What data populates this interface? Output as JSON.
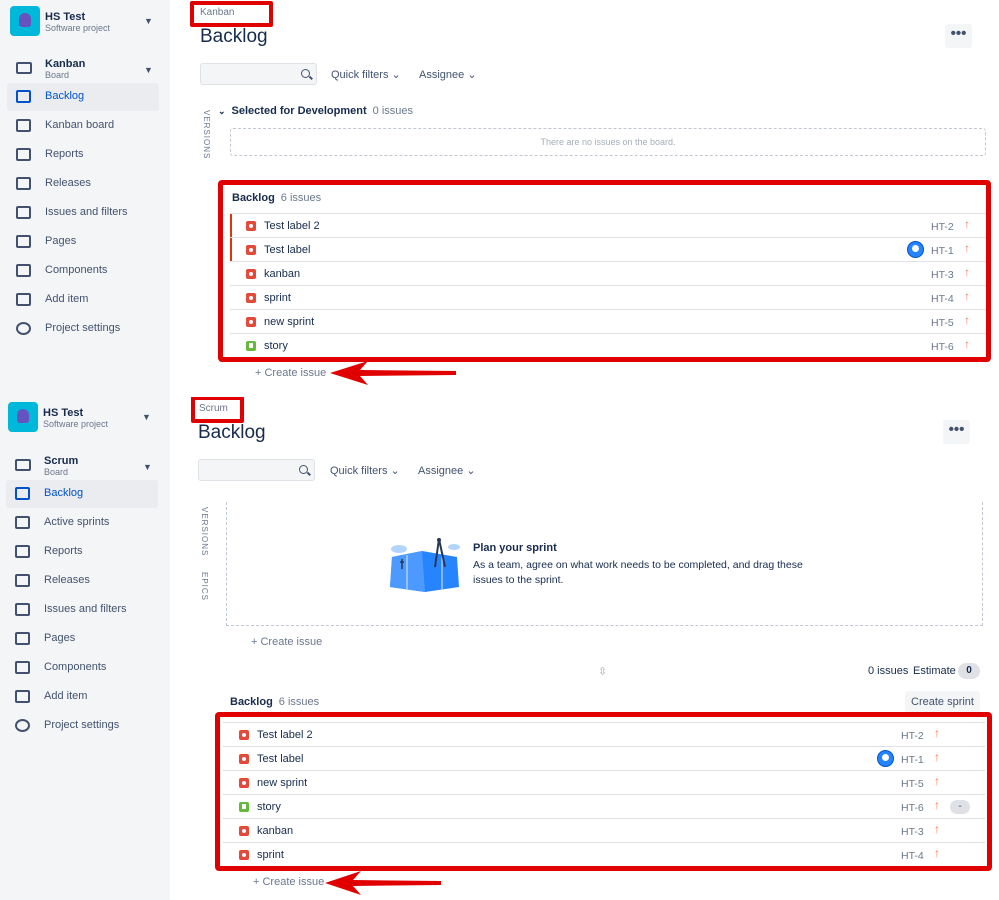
{
  "kanban": {
    "project": {
      "name": "HS Test",
      "type": "Software project"
    },
    "board": {
      "name": "Kanban",
      "type": "Board"
    },
    "nav": [
      "Backlog",
      "Kanban board",
      "Reports",
      "Releases",
      "Issues and filters",
      "Pages",
      "Components",
      "Add item",
      "Project settings"
    ],
    "tag": "Kanban",
    "title": "Backlog",
    "filters": {
      "quick": "Quick filters",
      "assignee": "Assignee"
    },
    "versions_tab": "VERSIONS",
    "selected_section": {
      "title": "Selected for Development",
      "count": "0 issues",
      "empty": "There are no issues on the board."
    },
    "backlog": {
      "title": "Backlog",
      "count": "6 issues",
      "issues": [
        {
          "summary": "Test label 2",
          "key": "HT-2",
          "type": "bug",
          "avatar": false,
          "marked": true
        },
        {
          "summary": "Test label",
          "key": "HT-1",
          "type": "bug",
          "avatar": true,
          "marked": true
        },
        {
          "summary": "kanban",
          "key": "HT-3",
          "type": "bug",
          "avatar": false,
          "marked": false
        },
        {
          "summary": "sprint",
          "key": "HT-4",
          "type": "bug",
          "avatar": false,
          "marked": false
        },
        {
          "summary": "new sprint",
          "key": "HT-5",
          "type": "bug",
          "avatar": false,
          "marked": false
        },
        {
          "summary": "story",
          "key": "HT-6",
          "type": "story",
          "avatar": false,
          "marked": false
        }
      ]
    },
    "create_issue": "+ Create issue"
  },
  "scrum": {
    "project": {
      "name": "HS Test",
      "type": "Software project"
    },
    "board": {
      "name": "Scrum",
      "type": "Board"
    },
    "nav": [
      "Backlog",
      "Active sprints",
      "Reports",
      "Releases",
      "Issues and filters",
      "Pages",
      "Components",
      "Add item",
      "Project settings"
    ],
    "tag": "Scrum",
    "title": "Backlog",
    "filters": {
      "quick": "Quick filters",
      "assignee": "Assignee"
    },
    "versions_tab": "VERSIONS",
    "epics_tab": "EPICS",
    "plan": {
      "title": "Plan your sprint",
      "desc": "As a team, agree on what work needs to be completed, and drag these issues to the sprint."
    },
    "create_issue_sprint": "+ Create issue",
    "sprint_stats": {
      "issues": "0 issues",
      "estimate_label": "Estimate",
      "estimate_value": "0"
    },
    "create_sprint": "Create sprint",
    "backlog": {
      "title": "Backlog",
      "count": "6 issues",
      "issues": [
        {
          "summary": "Test label 2",
          "key": "HT-2",
          "type": "bug",
          "avatar": false,
          "estimate": ""
        },
        {
          "summary": "Test label",
          "key": "HT-1",
          "type": "bug",
          "avatar": true,
          "estimate": ""
        },
        {
          "summary": "new sprint",
          "key": "HT-5",
          "type": "bug",
          "avatar": false,
          "estimate": ""
        },
        {
          "summary": "story",
          "key": "HT-6",
          "type": "story",
          "avatar": false,
          "estimate": "-"
        },
        {
          "summary": "kanban",
          "key": "HT-3",
          "type": "bug",
          "avatar": false,
          "estimate": ""
        },
        {
          "summary": "sprint",
          "key": "HT-4",
          "type": "bug",
          "avatar": false,
          "estimate": ""
        }
      ]
    },
    "create_issue": "+ Create issue"
  },
  "colors": {
    "highlight": "#e00000",
    "accent": "#0052cc",
    "bug": "#e5493a",
    "story": "#63ba3c",
    "priority": "#ff7452"
  }
}
